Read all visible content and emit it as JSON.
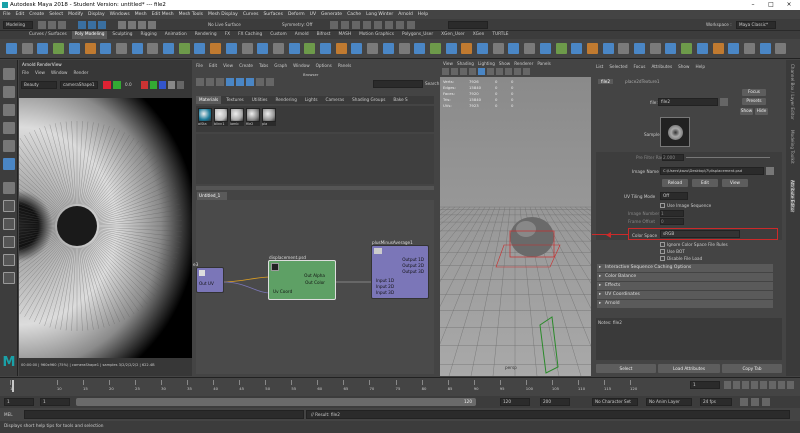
{
  "title": "Autodesk Maya 2018 - Student Version: untitled* --- file2",
  "menu": [
    "File",
    "Edit",
    "Create",
    "Select",
    "Modify",
    "Display",
    "Windows",
    "Mesh",
    "Edit Mesh",
    "Mesh Tools",
    "Mesh Display",
    "Curves",
    "Surfaces",
    "Deform",
    "UV",
    "Generate",
    "Cache",
    "Long Winter",
    "Arnold",
    "Help"
  ],
  "status": {
    "mode": "Modeling",
    "live": "No Live Surface",
    "symmetry": "Symmetry: Off",
    "workspace_label": "Workspace :",
    "workspace": "Maya Classic*"
  },
  "shelf_tabs": [
    "Curves / Surfaces",
    "Poly Modeling",
    "Sculpting",
    "Rigging",
    "Animation",
    "Rendering",
    "FX",
    "FX Caching",
    "Custom",
    "Arnold",
    "Bifrost",
    "MASH",
    "Motion Graphics",
    "Polygons_User",
    "XGen_User",
    "XGen",
    "TURTLE"
  ],
  "render_view": {
    "title": "Arnold RenderView",
    "menus": [
      "File",
      "View",
      "Window",
      "Render"
    ],
    "dropdown1": "Beauty",
    "dropdown2": "cameraShape1",
    "zoom": "0.0",
    "status": "00:00:00 | 960x960 (75%) | cameraShape1 | samples 3/2/2/2/2/2 | 622.4B"
  },
  "hypershade": {
    "menus": [
      "File",
      "Edit",
      "View",
      "Create",
      "Tabs",
      "Graph",
      "Window",
      "Options",
      "Panels"
    ],
    "browser_label": "Browser",
    "lib_tabs": [
      "Materials",
      "Textures",
      "Utilities",
      "Rendering",
      "Lights",
      "Cameras",
      "Shading Groups",
      "Bake S"
    ],
    "swatches": [
      "aiSta",
      "blinn1",
      "lamb",
      "file2",
      "pla"
    ],
    "graph_tab": "Untitled_1",
    "search_label": "Search",
    "nodes": {
      "left": {
        "title": "e3",
        "out": "Out UV"
      },
      "mid": {
        "title": "displacement.psd",
        "out1": "Out Alpha",
        "out2": "Out Color",
        "in1": "Uv Coord"
      },
      "right": {
        "title": "plusMinusAverage1",
        "out1": "Output 1D",
        "out2": "Output 2D",
        "out3": "Output 3D",
        "in1": "Input 1D",
        "in2": "Input 2D",
        "in3": "Input 3D"
      }
    }
  },
  "viewport": {
    "menus": [
      "View",
      "Shading",
      "Lighting",
      "Show",
      "Renderer",
      "Panels"
    ],
    "hud": [
      {
        "k": "Verts:",
        "v": "7926"
      },
      {
        "k": "Edges:",
        "v": "15840"
      },
      {
        "k": "Faces:",
        "v": "7920"
      },
      {
        "k": "Tris:",
        "v": "15840"
      },
      {
        "k": "UVs:",
        "v": "7923"
      }
    ],
    "cam": "persp"
  },
  "attr": {
    "menus": [
      "List",
      "Selected",
      "Focus",
      "Attributes",
      "Show",
      "Help"
    ],
    "tab": "file2",
    "tab2": "place2dTexture1",
    "file_label": "file:",
    "file_value": "file2",
    "focus": "Focus",
    "presets": "Presets",
    "show": "Show",
    "hide": "Hide",
    "sample_label": "Sample",
    "filter_label": "Pre Filter Radius",
    "filter_value": "2.000",
    "image_label": "Image Name",
    "image_value": "C:\\Users\\kazu\\Desktop\\7\\displacement.psd",
    "reload": "Reload",
    "edit": "Edit",
    "view": "View",
    "uvtiling_label": "UV Tiling Mode",
    "uvtiling_value": "Off",
    "use_seq": "Use Image Sequence",
    "img_num": "Image Number",
    "frame_off": "Frame Offset",
    "img_num_v": "1",
    "frame_v": "0",
    "colorspace_label": "Color Space",
    "colorspace_value": "sRGB",
    "ignore": "Ignore Color Space File Rules",
    "use_bot": "Use BOT",
    "disable": "Disable File Load",
    "sections": [
      "Interactive Sequence Caching Options",
      "Color Balance",
      "Effects",
      "UV Coordinates",
      "Arnold"
    ],
    "notes": "Notes:  file2",
    "select": "Select",
    "load": "Load Attributes",
    "copy": "Copy Tab"
  },
  "side_tabs": [
    "Channel Box / Layer Editor",
    "Modeling Toolkit",
    "Attribute Editor"
  ],
  "time": {
    "ticks": [
      "1",
      "10",
      "15",
      "20",
      "25",
      "30",
      "35",
      "40",
      "45",
      "50",
      "55",
      "60",
      "65",
      "70",
      "75",
      "80",
      "85",
      "90",
      "95",
      "100",
      "105",
      "110",
      "115",
      "120"
    ],
    "current": "1"
  },
  "range": {
    "start": "1",
    "start2": "1",
    "mid": "120",
    "end": "120",
    "end2": "200",
    "char": "No Character Set",
    "anim": "No Anim Layer",
    "fps": "24 fps"
  },
  "cmd": {
    "lang": "MEL",
    "result": "// Result: file2"
  },
  "help": "Displays short help tips for tools and selection",
  "colors": {
    "hl": "#cc2a2a",
    "node": "#5ea065",
    "blue": "#7b76b8"
  }
}
